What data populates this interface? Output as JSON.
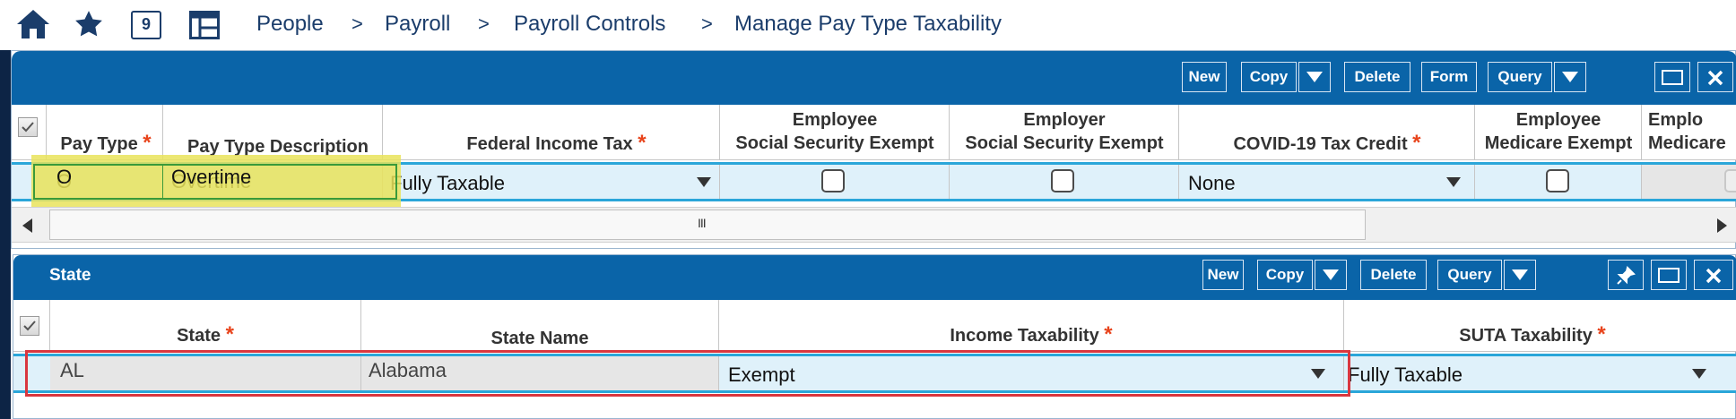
{
  "breadcrumb": {
    "items": [
      "People",
      "Payroll",
      "Payroll Controls",
      "Manage Pay Type Taxability"
    ],
    "separator": ">",
    "calendar_day": "9"
  },
  "pay_type_grid": {
    "toolbar": {
      "new": "New",
      "copy": "Copy",
      "delete": "Delete",
      "form": "Form",
      "query": "Query"
    },
    "columns": {
      "pay_type": "Pay Type",
      "pay_type_description": "Pay Type Description",
      "federal_income_tax": "Federal Income Tax",
      "employee_ss_exempt_1": "Employee",
      "employee_ss_exempt_2": "Social Security Exempt",
      "employer_ss_exempt_1": "Employer",
      "employer_ss_exempt_2": "Social Security Exempt",
      "covid_credit": "COVID-19 Tax Credit",
      "employee_medicare_1": "Employee",
      "employee_medicare_2": "Medicare Exempt",
      "employer_medicare_1": "Emplo",
      "employer_medicare_2": "Medicare"
    },
    "required_mark": "*",
    "row": {
      "pay_type": "O",
      "description": "Overtime",
      "federal_income_tax": "Fully Taxable",
      "covid_credit": "None"
    },
    "scrollbar_grip": "III"
  },
  "state_grid": {
    "title": "State",
    "toolbar": {
      "new": "New",
      "copy": "Copy",
      "delete": "Delete",
      "query": "Query"
    },
    "columns": {
      "state": "State",
      "state_name": "State Name",
      "income_taxability": "Income Taxability",
      "suta_taxability": "SUTA Taxability"
    },
    "row": {
      "state": "AL",
      "state_name": "Alabama",
      "income_taxability": "Exempt",
      "suta_taxability": "Fully Taxable"
    }
  },
  "colors": {
    "header_blue": "#0a64a8",
    "navy": "#1b3d6b",
    "row_blue": "#dff1fa",
    "row_border": "#2aa6d9",
    "highlight_yellow": "#e9e35a",
    "annotation_red": "#d9373f",
    "required_red": "#e8441c"
  }
}
